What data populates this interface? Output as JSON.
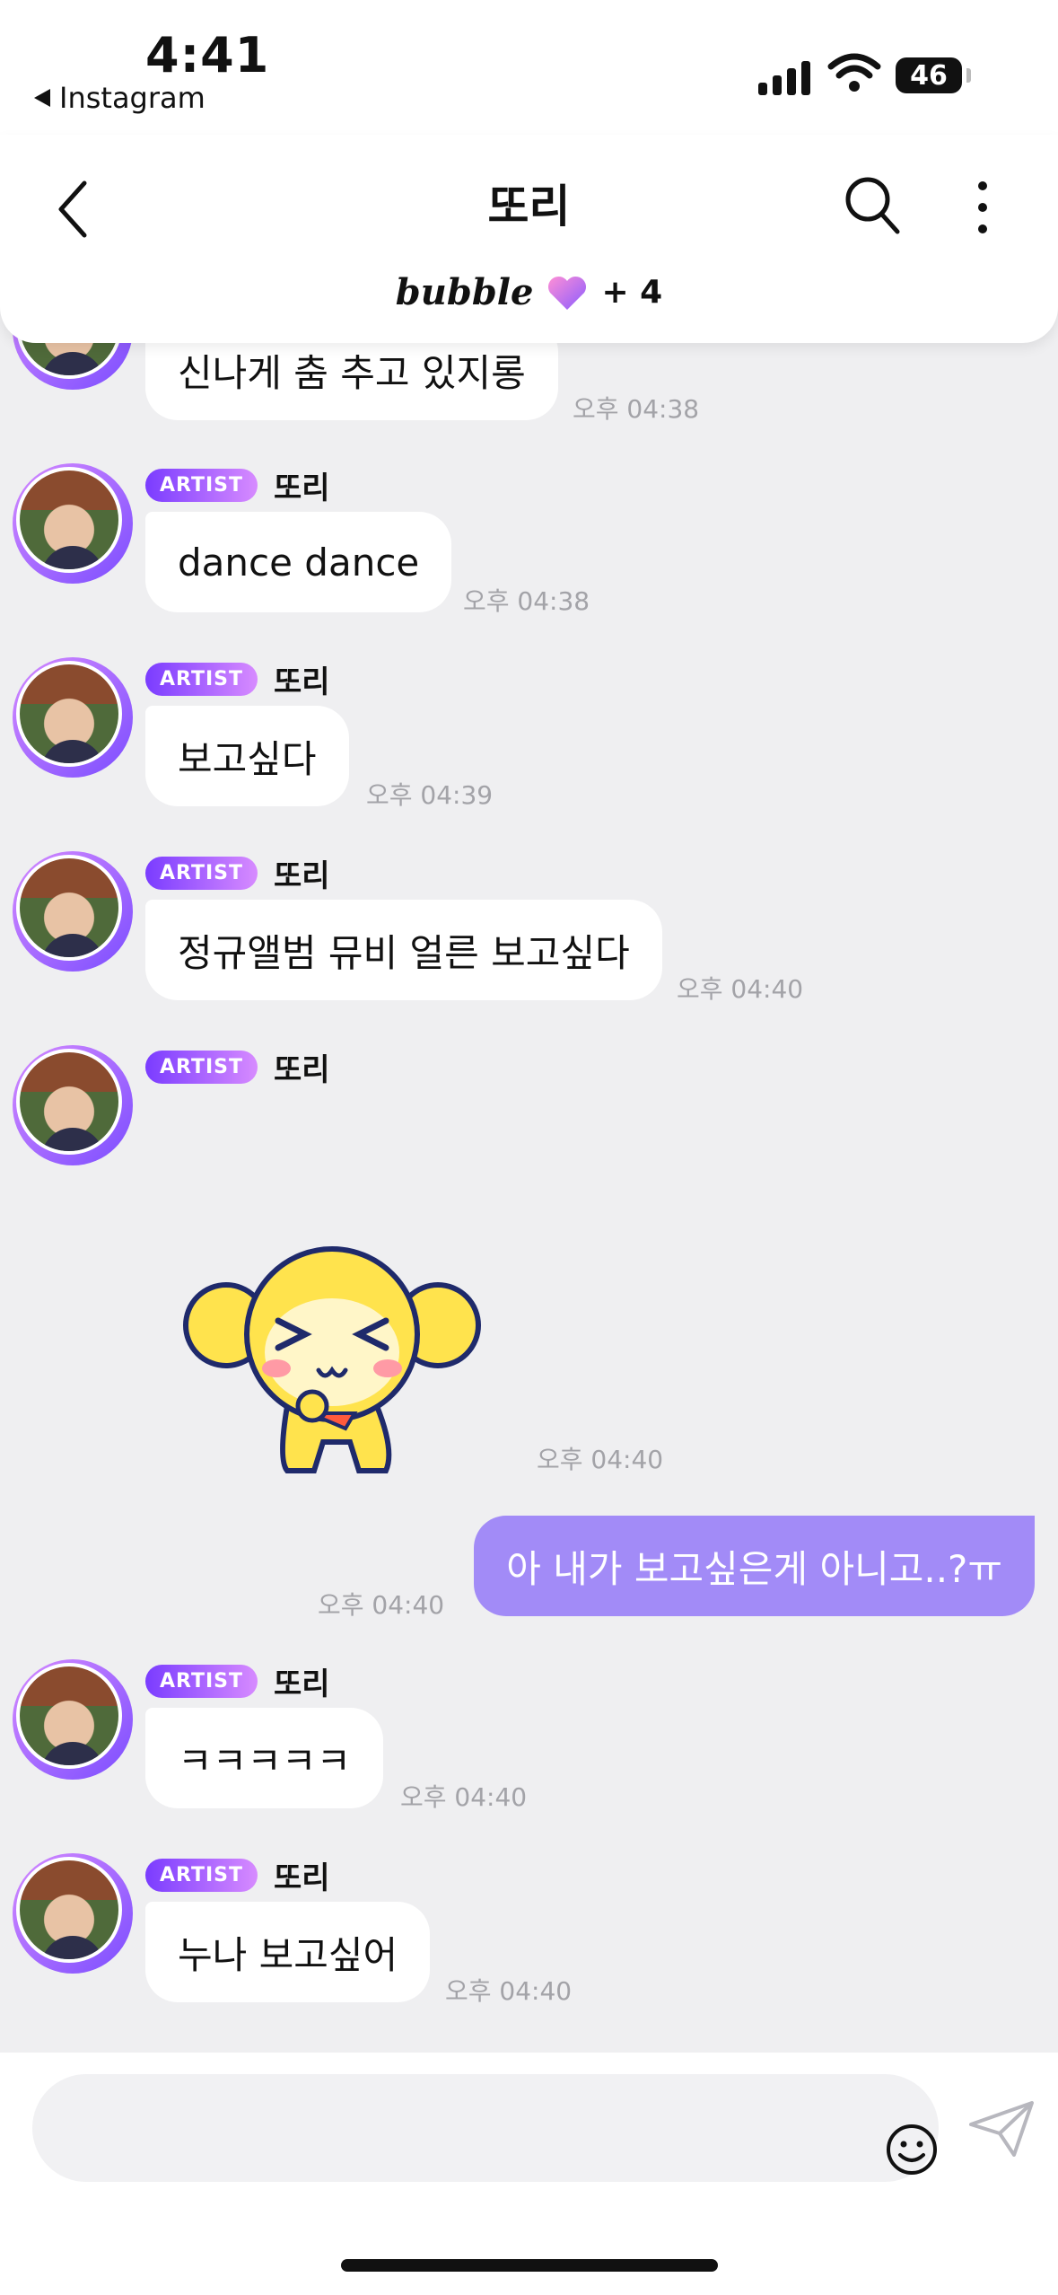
{
  "status_bar": {
    "time": "4:41",
    "back_app": "Instagram",
    "battery": "46"
  },
  "header": {
    "title": "또리",
    "brand": "bubble",
    "member_count": "+ 4"
  },
  "messages": [
    {
      "text": "신나게 춤 추고 있지롱",
      "time": "오후 04:38"
    },
    {
      "badge": "ARTIST",
      "name": "또리",
      "text": "dance dance",
      "time": "오후 04:38"
    },
    {
      "badge": "ARTIST",
      "name": "또리",
      "text": "보고싶다",
      "time": "오후 04:39"
    },
    {
      "badge": "ARTIST",
      "name": "또리",
      "text": "정규앨범 뮤비 얼른 보고싶다",
      "time": "오후 04:40"
    },
    {
      "badge": "ARTIST",
      "name": "또리",
      "sticker": "yellow-monkey-sticker",
      "time": "오후 04:40"
    },
    {
      "mine": true,
      "text": "아 내가 보고싶은게 아니고..?ㅠ",
      "time": "오후 04:40"
    },
    {
      "badge": "ARTIST",
      "name": "또리",
      "text": "ㅋㅋㅋㅋㅋ",
      "time": "오후 04:40"
    },
    {
      "badge": "ARTIST",
      "name": "또리",
      "text": "누나 보고싶어",
      "time": "오후 04:40"
    }
  ],
  "input": {
    "placeholder": ""
  },
  "colors": {
    "accent": "#a28bf7",
    "badge_start": "#7a3cff",
    "badge_end": "#d78bff",
    "background": "#efeff1"
  }
}
